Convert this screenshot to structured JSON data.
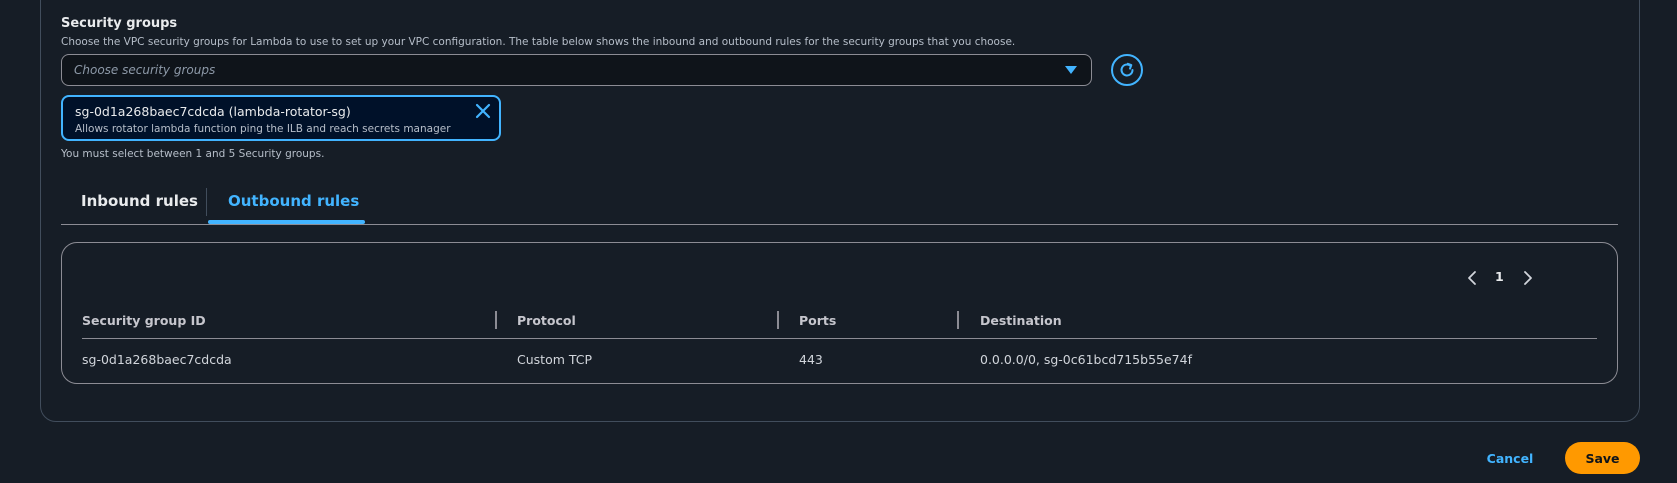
{
  "security_groups": {
    "title": "Security groups",
    "description": "Choose the VPC security groups for Lambda to use to set up your VPC configuration. The table below shows the inbound and outbound rules for the security groups that you choose.",
    "select_placeholder": "Choose security groups",
    "selected_token": {
      "label": "sg-0d1a268baec7cdcda (lambda-rotator-sg)",
      "description": "Allows rotator lambda function ping the ILB and reach secrets manager"
    },
    "constraint_text": "You must select between 1 and 5 Security groups."
  },
  "tabs": [
    {
      "label": "Inbound rules",
      "active": false
    },
    {
      "label": "Outbound rules",
      "active": true
    }
  ],
  "pagination": {
    "current_page": "1"
  },
  "table": {
    "columns": [
      "Security group ID",
      "Protocol",
      "Ports",
      "Destination"
    ],
    "rows": [
      [
        "sg-0d1a268baec7cdcda",
        "Custom TCP",
        "443",
        "0.0.0.0/0, sg-0c61bcd715b55e74f"
      ]
    ]
  },
  "actions": {
    "cancel_label": "Cancel",
    "save_label": "Save"
  },
  "colors": {
    "background": "#161d26",
    "accent": "#42b4ff",
    "primary_button": "#ff9900",
    "border": "#8c8c94"
  },
  "icons": {
    "dropdown": "caret-down-icon",
    "refresh": "refresh-icon",
    "remove_token": "close-icon",
    "prev_page": "chevron-left-icon",
    "next_page": "chevron-right-icon"
  }
}
